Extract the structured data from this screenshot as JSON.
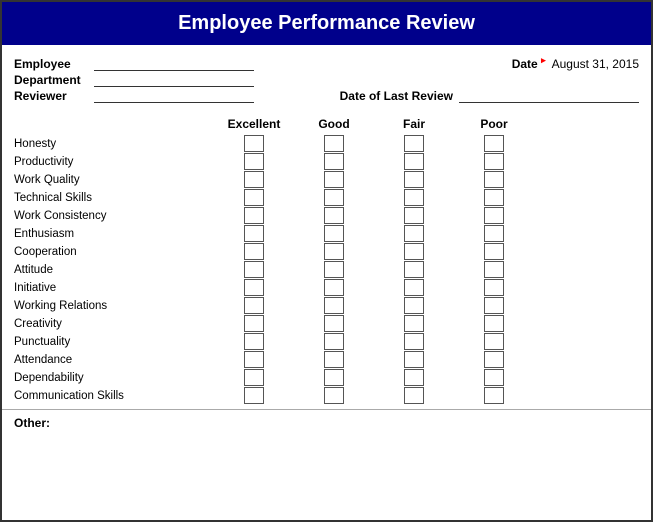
{
  "header": {
    "title": "Employee Performance Review"
  },
  "form": {
    "employee_label": "Employee",
    "department_label": "Department",
    "reviewer_label": "Reviewer",
    "date_label": "Date",
    "date_value": "August 31, 2015",
    "last_review_label": "Date of Last Review"
  },
  "ratings": {
    "columns": [
      "Excellent",
      "Good",
      "Fair",
      "Poor"
    ],
    "criteria": [
      "Honesty",
      "Productivity",
      "Work Quality",
      "Technical Skills",
      "Work Consistency",
      "Enthusiasm",
      "Cooperation",
      "Attitude",
      "Initiative",
      "Working Relations",
      "Creativity",
      "Punctuality",
      "Attendance",
      "Dependability",
      "Communication Skills"
    ]
  },
  "other_label": "Other:"
}
